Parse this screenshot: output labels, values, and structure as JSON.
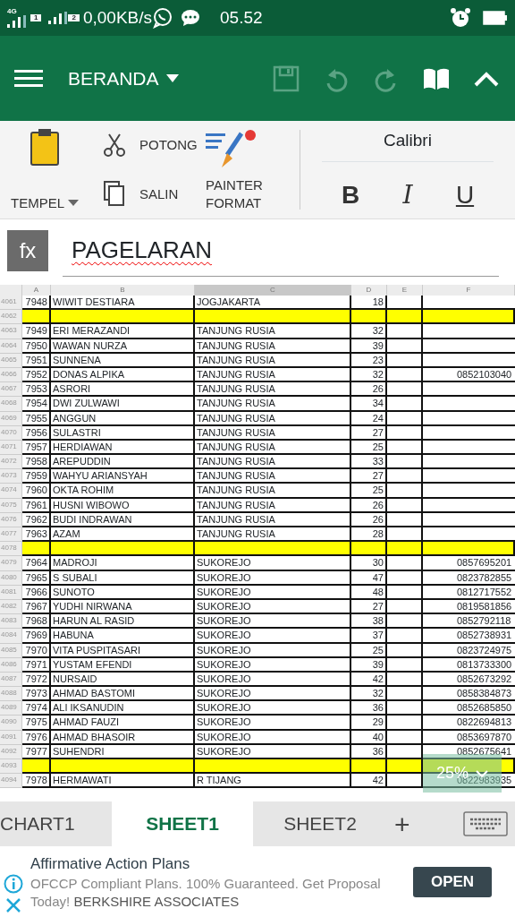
{
  "status_bar": {
    "network_type": "4G",
    "sims": [
      "1",
      "2"
    ],
    "speed": "0,00KB/s",
    "time": "05.52"
  },
  "toolbar": {
    "tab_label": "BERANDA",
    "buttons": [
      {
        "kind": "save",
        "disabled": true
      },
      {
        "kind": "undo",
        "disabled": true
      },
      {
        "kind": "redo",
        "disabled": true
      },
      {
        "kind": "book",
        "disabled": false
      },
      {
        "kind": "collapse",
        "disabled": false
      }
    ]
  },
  "ribbon": {
    "paste": "TEMPEL",
    "cut": "POTONG",
    "copy": "SALIN",
    "painter": "PAINTER FORMAT",
    "font": "Calibri",
    "styles": [
      "B",
      "I",
      "U"
    ]
  },
  "formula_bar": {
    "label": "fx",
    "value": "PAGELARAN"
  },
  "sheet": {
    "columns": [
      {
        "label": "A",
        "selected": false
      },
      {
        "label": "B",
        "selected": false
      },
      {
        "label": "C",
        "selected": true
      },
      {
        "label": "D",
        "selected": false
      },
      {
        "label": "E",
        "selected": false
      },
      {
        "label": "F",
        "selected": false
      }
    ],
    "rows": [
      {
        "row_number": "4061",
        "kind": "data",
        "id": "7948",
        "name": "WIWIT DESTIARA",
        "place": "JOGJAKARTA",
        "age": "18"
      },
      {
        "row_number": "4062",
        "kind": "separator"
      },
      {
        "row_number": "4063",
        "kind": "data",
        "id": "7949",
        "name": "ERI MERAZANDI",
        "place": "TANJUNG RUSIA",
        "age": "32"
      },
      {
        "row_number": "4064",
        "kind": "data",
        "id": "7950",
        "name": "WAWAN NURZA",
        "place": "TANJUNG RUSIA",
        "age": "39"
      },
      {
        "row_number": "4065",
        "kind": "data",
        "id": "7951",
        "name": "SUNNENA",
        "place": "TANJUNG RUSIA",
        "age": "23"
      },
      {
        "row_number": "4066",
        "kind": "data",
        "id": "7952",
        "name": "DONAS ALPIKA",
        "place": "TANJUNG RUSIA",
        "age": "32",
        "phone": "0852103040"
      },
      {
        "row_number": "4067",
        "kind": "data",
        "id": "7953",
        "name": "ASRORI",
        "place": "TANJUNG RUSIA",
        "age": "26"
      },
      {
        "row_number": "4068",
        "kind": "data",
        "id": "7954",
        "name": "DWI ZULWAWI",
        "place": "TANJUNG RUSIA",
        "age": "34"
      },
      {
        "row_number": "4069",
        "kind": "data",
        "id": "7955",
        "name": "ANGGUN",
        "place": "TANJUNG RUSIA",
        "age": "24"
      },
      {
        "row_number": "4070",
        "kind": "data",
        "id": "7956",
        "name": "SULASTRI",
        "place": "TANJUNG RUSIA",
        "age": "27"
      },
      {
        "row_number": "4071",
        "kind": "data",
        "id": "7957",
        "name": "HERDIAWAN",
        "place": "TANJUNG RUSIA",
        "age": "25"
      },
      {
        "row_number": "4072",
        "kind": "data",
        "id": "7958",
        "name": "AREPUDDIN",
        "place": "TANJUNG RUSIA",
        "age": "33"
      },
      {
        "row_number": "4073",
        "kind": "data",
        "id": "7959",
        "name": "WAHYU ARIANSYAH",
        "place": "TANJUNG RUSIA",
        "age": "27"
      },
      {
        "row_number": "4074",
        "kind": "data",
        "id": "7960",
        "name": "OKTA ROHIM",
        "place": "TANJUNG RUSIA",
        "age": "25"
      },
      {
        "row_number": "4075",
        "kind": "data",
        "id": "7961",
        "name": "HUSNI WIBOWO",
        "place": "TANJUNG RUSIA",
        "age": "26"
      },
      {
        "row_number": "4076",
        "kind": "data",
        "id": "7962",
        "name": "BUDI INDRAWAN",
        "place": "TANJUNG RUSIA",
        "age": "26"
      },
      {
        "row_number": "4077",
        "kind": "data",
        "id": "7963",
        "name": "AZAM",
        "place": "TANJUNG RUSIA",
        "age": "28"
      },
      {
        "row_number": "4078",
        "kind": "separator"
      },
      {
        "row_number": "4079",
        "kind": "data",
        "id": "7964",
        "name": "MADROJI",
        "place": "SUKOREJO",
        "age": "30",
        "phone": "0857695201"
      },
      {
        "row_number": "4080",
        "kind": "data",
        "id": "7965",
        "name": "S SUBALI",
        "place": "SUKOREJO",
        "age": "47",
        "phone": "0823782855"
      },
      {
        "row_number": "4081",
        "kind": "data",
        "id": "7966",
        "name": "SUNOTO",
        "place": "SUKOREJO",
        "age": "48",
        "phone": "0812717552"
      },
      {
        "row_number": "4082",
        "kind": "data",
        "id": "7967",
        "name": "YUDHI NIRWANA",
        "place": "SUKOREJO",
        "age": "27",
        "phone": "0819581856"
      },
      {
        "row_number": "4083",
        "kind": "data",
        "id": "7968",
        "name": "HARUN AL RASID",
        "place": "SUKOREJO",
        "age": "38",
        "phone": "0852792118"
      },
      {
        "row_number": "4084",
        "kind": "data",
        "id": "7969",
        "name": "HABUNA",
        "place": "SUKOREJO",
        "age": "37",
        "phone": "0852738931"
      },
      {
        "row_number": "4085",
        "kind": "data",
        "id": "7970",
        "name": "VITA PUSPITASARI",
        "place": "SUKOREJO",
        "age": "25",
        "phone": "0823724975"
      },
      {
        "row_number": "4086",
        "kind": "data",
        "id": "7971",
        "name": "YUSTAM EFENDI",
        "place": "SUKOREJO",
        "age": "39",
        "phone": "0813733300"
      },
      {
        "row_number": "4087",
        "kind": "data",
        "id": "7972",
        "name": "NURSAID",
        "place": "SUKOREJO",
        "age": "42",
        "phone": "0852673292"
      },
      {
        "row_number": "4088",
        "kind": "data",
        "id": "7973",
        "name": "AHMAD BASTOMI",
        "place": "SUKOREJO",
        "age": "32",
        "phone": "0858384873"
      },
      {
        "row_number": "4089",
        "kind": "data",
        "id": "7974",
        "name": "ALI IKSANUDIN",
        "place": "SUKOREJO",
        "age": "36",
        "phone": "0852685850"
      },
      {
        "row_number": "4090",
        "kind": "data",
        "id": "7975",
        "name": "AHMAD FAUZI",
        "place": "SUKOREJO",
        "age": "29",
        "phone": "0822694813"
      },
      {
        "row_number": "4091",
        "kind": "data",
        "id": "7976",
        "name": "AHMAD BHASOIR",
        "place": "SUKOREJO",
        "age": "40",
        "phone": "0853697870"
      },
      {
        "row_number": "4092",
        "kind": "data",
        "id": "7977",
        "name": "SUHENDRI",
        "place": "SUKOREJO",
        "age": "36",
        "phone": "0852675641"
      },
      {
        "row_number": "4093",
        "kind": "separator"
      },
      {
        "row_number": "4094",
        "kind": "data",
        "id": "7978",
        "name": "HERMAWATI",
        "place": "R TIJANG",
        "age": "42",
        "phone": "0822983935"
      }
    ],
    "zoom": "25%"
  },
  "sheet_tabs": [
    {
      "label": "CHART1",
      "selected": false
    },
    {
      "label": "SHEET1",
      "selected": true
    },
    {
      "label": "SHEET2",
      "selected": false
    }
  ],
  "add_sheet": "+",
  "ad": {
    "title": "Affirmative Action Plans",
    "text": "OFCCP Compliant Plans. 100% Guaranteed. Get Proposal Today!",
    "advertiser": "BERKSHIRE ASSOCIATES",
    "button": "OPEN"
  }
}
